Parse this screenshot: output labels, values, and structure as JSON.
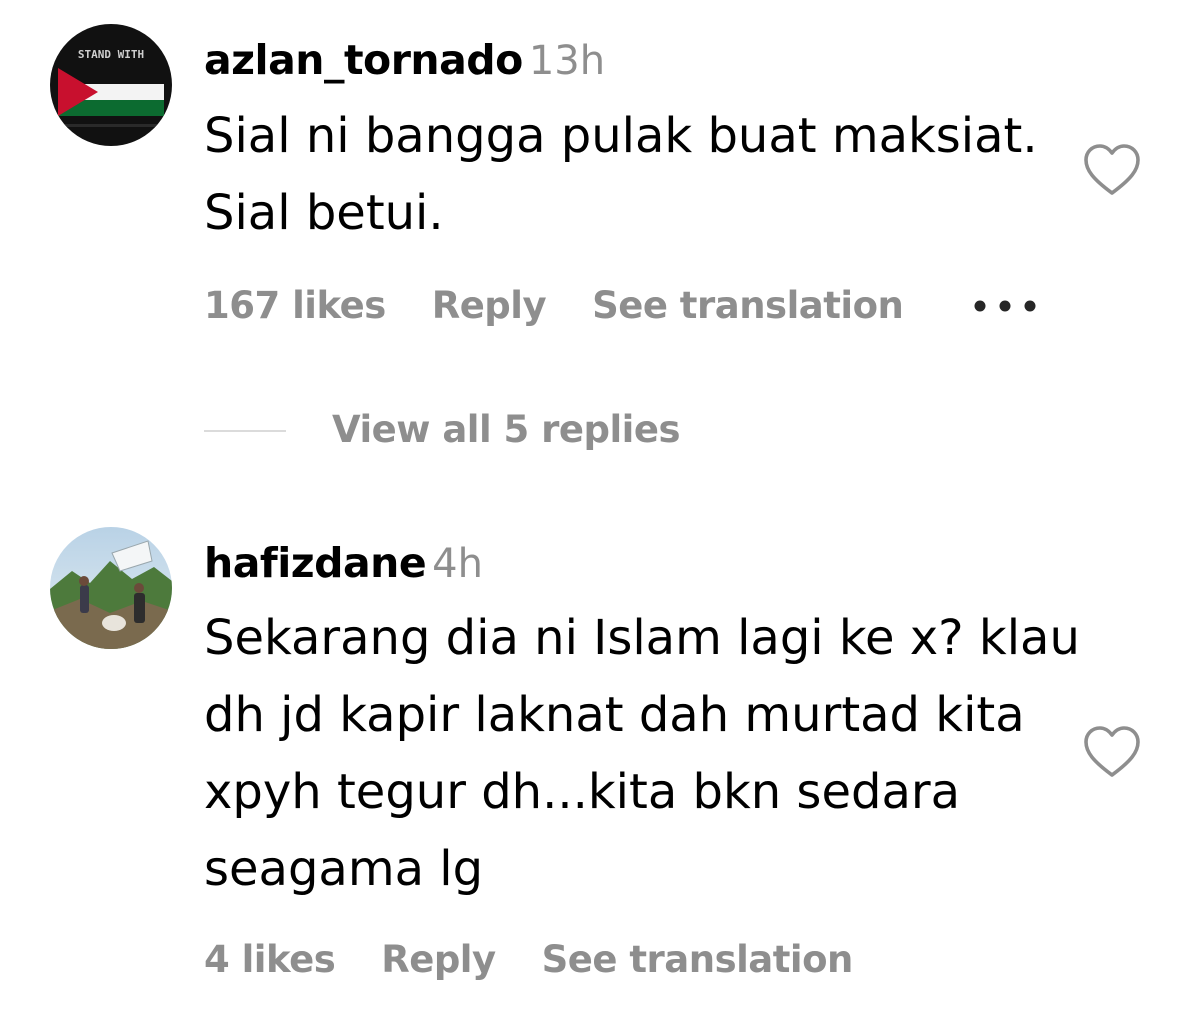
{
  "comments": [
    {
      "username": "azlan_tornado",
      "time": "13h",
      "avatar_text": "STAND WITH",
      "text": "Sial ni bangga pulak buat maksiat. Sial betui.",
      "likes": "167 likes",
      "reply_label": "Reply",
      "translate_label": "See translation",
      "more_icon": "more-options-icon",
      "like_icon": "heart-outline-icon",
      "view_replies_label": "View all 5 replies"
    },
    {
      "username": "hafizdane",
      "time": "4h",
      "text": "Sekarang dia ni Islam lagi ke x? klau dh jd kapir laknat dah murtad kita xpyh tegur dh...kita bkn sedara seagama lg",
      "likes": "4 likes",
      "reply_label": "Reply",
      "translate_label": "See translation",
      "like_icon": "heart-outline-icon"
    }
  ],
  "colors": {
    "primary_text": "#000000",
    "secondary_text": "#8e8e8e",
    "divider": "#dbdbdb",
    "background": "#ffffff"
  }
}
